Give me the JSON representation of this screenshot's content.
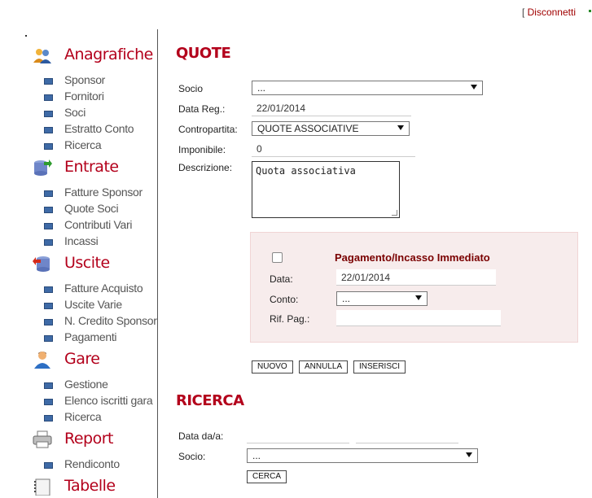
{
  "header": {
    "bracket": "[",
    "disconnect_label": "Disconnetti"
  },
  "sidebar": {
    "sections": [
      {
        "title": "Anagrafiche",
        "icon": "users-icon",
        "items": [
          "Sponsor",
          "Fornitori",
          "Soci",
          "Estratto Conto",
          "Ricerca"
        ]
      },
      {
        "title": "Entrate",
        "icon": "database-in-icon",
        "items": [
          "Fatture Sponsor",
          "Quote Soci",
          "Contributi Vari",
          "Incassi"
        ]
      },
      {
        "title": "Uscite",
        "icon": "database-out-icon",
        "items": [
          "Fatture Acquisto",
          "Uscite Varie",
          "N. Credito Sponsor",
          "Pagamenti"
        ]
      },
      {
        "title": "Gare",
        "icon": "user-icon",
        "items": [
          "Gestione",
          "Elenco iscritti gara",
          "Ricerca"
        ]
      },
      {
        "title": "Report",
        "icon": "printer-icon",
        "items": [
          "Rendiconto"
        ]
      },
      {
        "title": "Tabelle",
        "icon": "notebook-icon",
        "items": []
      }
    ]
  },
  "quote_form": {
    "heading": "QUOTE",
    "socio_label": "Socio",
    "socio_value": "...",
    "data_reg_label": "Data Reg.:",
    "data_reg_value": "22/01/2014",
    "contropartita_label": "Contropartita:",
    "contropartita_value": "QUOTE ASSOCIATIVE",
    "imponibile_label": "Imponibile:",
    "imponibile_value": "0",
    "descrizione_label": "Descrizione:",
    "descrizione_value": "Quota associativa",
    "payment": {
      "title": "Pagamento/Incasso Immediato",
      "checked": false,
      "data_label": "Data:",
      "data_value": "22/01/2014",
      "conto_label": "Conto:",
      "conto_value": "...",
      "rif_label": "Rif. Pag.:",
      "rif_value": ""
    },
    "buttons": {
      "nuovo": "NUOVO",
      "annulla": "ANNULLA",
      "inserisci": "INSERISCI"
    }
  },
  "search_form": {
    "heading": "RICERCA",
    "data_label": "Data da/a:",
    "data_from": "",
    "data_to": "",
    "socio_label": "Socio:",
    "socio_value": "...",
    "search_button": "CERCA"
  },
  "colors": {
    "accent": "#b3001b",
    "payment_bg": "#f7ecec",
    "bullet": "#3e6aa6"
  }
}
